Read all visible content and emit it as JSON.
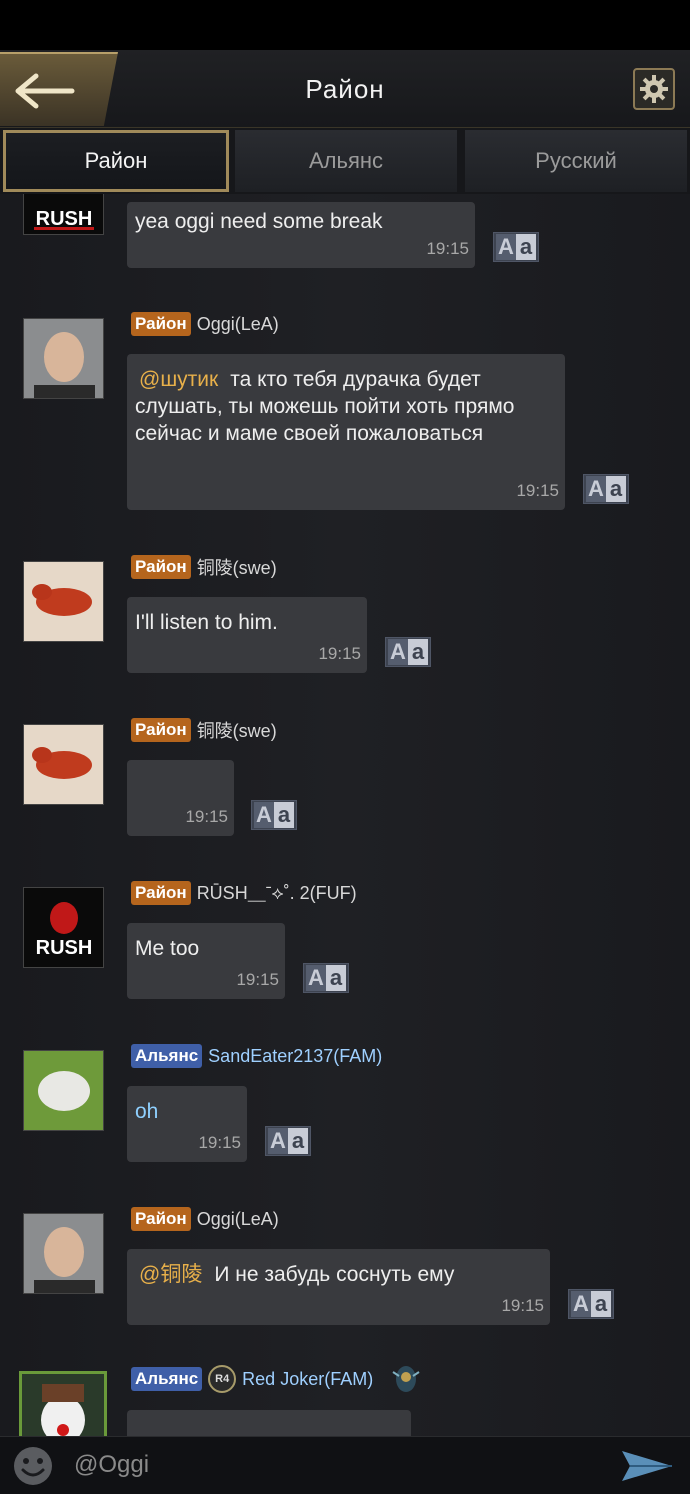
{
  "header": {
    "title": "Район"
  },
  "tabs": [
    "Район",
    "Альянс",
    "Русский"
  ],
  "messages": [
    {
      "text": "yea oggi need some break",
      "time": "19:15"
    },
    {
      "badge": "Район",
      "user": "Oggi(LeA)",
      "mention": "@шутик",
      "text": "та кто тебя дурачка будет слушать, ты можешь пойти хоть прямо сейчас и маме своей пожаловаться",
      "time": "19:15"
    },
    {
      "badge": "Район",
      "user": "铜陵(swe)",
      "text": "I'll listen to him.",
      "time": "19:15"
    },
    {
      "badge": "Район",
      "user": "铜陵(swe)",
      "text": "",
      "time": "19:15"
    },
    {
      "badge": "Район",
      "user": "RŪSH⸏ˉ⟡˚. 2(FUF)",
      "text": "Me too",
      "time": "19:15"
    },
    {
      "badge": "Альянс",
      "user": "SandEater2137(FAM)",
      "text": "oh",
      "time": "19:15"
    },
    {
      "badge": "Район",
      "user": "Oggi(LeA)",
      "mention": "@铜陵",
      "text": "И не забудь соснуть ему",
      "time": "19:15"
    },
    {
      "badge": "Альянс",
      "rank": "R4",
      "user": "Red Joker(FAM)"
    }
  ],
  "input": {
    "value": "@Oggi"
  },
  "translate_label": [
    "A",
    "a"
  ],
  "colors": {
    "district_badge": "#b5651d",
    "alliance_badge": "#3f5fa8",
    "mention": "#e8b04a",
    "gold_border": "#a08a5a"
  },
  "icons": {
    "back": "arrow-left-icon",
    "settings": "gear-icon",
    "emoji": "smiley-icon",
    "send": "paper-plane-icon",
    "translate": "translate-icon"
  }
}
